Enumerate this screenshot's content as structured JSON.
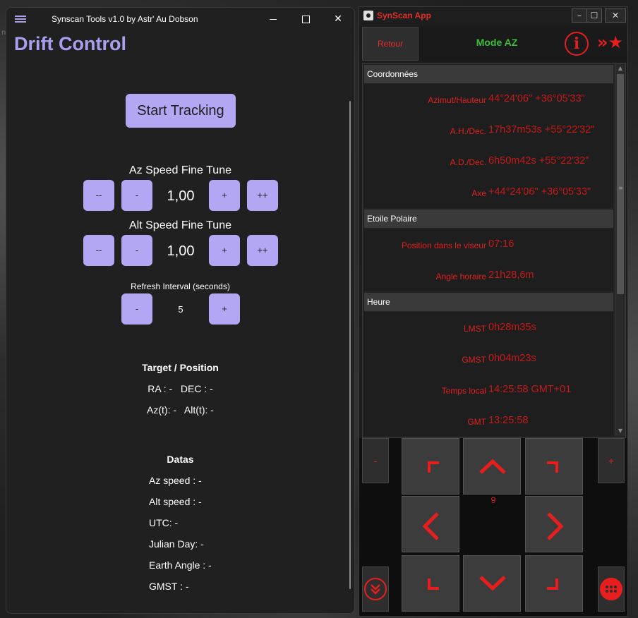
{
  "background": {
    "label": "navigation"
  },
  "drift_window": {
    "title": "Synscan Tools v1.0 by Astr' Au Dobson",
    "heading": "Drift Control",
    "start_button": "Start Tracking",
    "az_fine_tune": {
      "label": "Az Speed Fine Tune",
      "dec2": "--",
      "dec1": "-",
      "value": "1,00",
      "inc1": "+",
      "inc2": "++"
    },
    "alt_fine_tune": {
      "label": "Alt Speed Fine Tune",
      "dec2": "--",
      "dec1": "-",
      "value": "1,00",
      "inc1": "+",
      "inc2": "++"
    },
    "refresh": {
      "label": "Refresh Interval (seconds)",
      "dec": "-",
      "value": "5",
      "inc": "+"
    },
    "target": {
      "heading": "Target / Position",
      "radec": "RA : -   DEC : -",
      "azalt": "Az(t): -   Alt(t): -"
    },
    "datas": {
      "heading": "Datas",
      "az_speed": "Az speed : -",
      "alt_speed": "Alt speed : -",
      "utc": "UTC: -",
      "julian_day": "Julian Day: -",
      "earth_angle": "Earth Angle : -",
      "gmst": "GMST : -"
    }
  },
  "synscan_window": {
    "title": "SynScan App",
    "back_button": "Retour",
    "mode": "Mode AZ",
    "info_icon": "i",
    "favorite_icon": "»★",
    "sections": {
      "coords": {
        "heading": "Coordonnées",
        "rows": [
          {
            "label": "Azimut/Hauteur",
            "value": "44°24'06\" +36°05'33\""
          },
          {
            "label": "A.H./Dec.",
            "value": "17h37m53s +55°22'32\""
          },
          {
            "label": "A.D./Dec.",
            "value": "6h50m42s +55°22'32\""
          },
          {
            "label": "Axe",
            "value": "+44°24'06\" +36°05'33\""
          }
        ]
      },
      "polar": {
        "heading": "Etoile Polaire",
        "rows": [
          {
            "label": "Position dans le viseur",
            "value": "07:16"
          },
          {
            "label": "Angle horaire",
            "value": "21h28,6m"
          }
        ]
      },
      "time": {
        "heading": "Heure",
        "rows": [
          {
            "label": "LMST",
            "value": "0h28m35s"
          },
          {
            "label": "GMST",
            "value": "0h04m23s"
          },
          {
            "label": "Temps local",
            "value": "14:25:58 GMT+01"
          },
          {
            "label": "GMT",
            "value": "13:25:58"
          }
        ]
      }
    },
    "pad": {
      "speed_minus": "-",
      "speed_plus": "+",
      "speed_value": "9"
    },
    "colors": {
      "accent_red": "#e81e1e",
      "mode_green": "#3bbf3b",
      "drift_purple": "#b3a7f3"
    }
  }
}
